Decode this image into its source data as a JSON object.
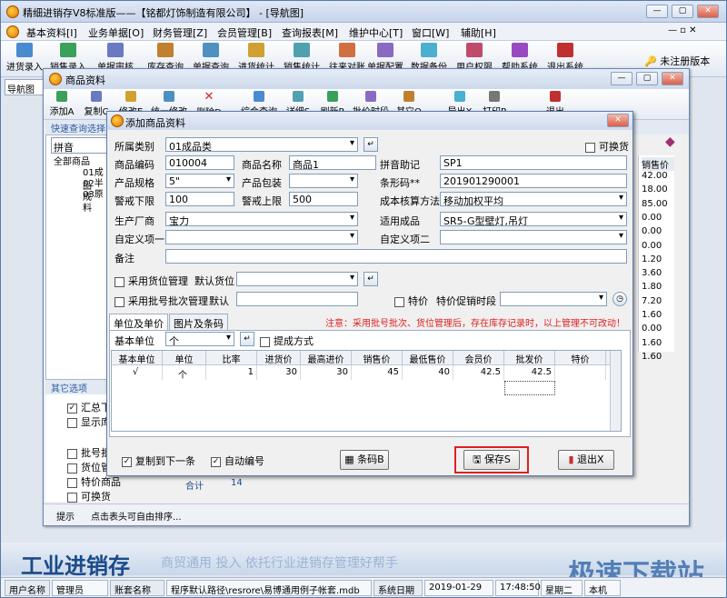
{
  "app": {
    "title": "精细进销存V8标准版——【铭都灯饰制造有限公司】 - [导航图]"
  },
  "menu": [
    "基本资料[I]",
    "业务单据[O]",
    "财务管理[Z]",
    "会员管理[B]",
    "查询报表[M]",
    "维护中心[T]",
    "窗口[W]",
    "辅助[H]"
  ],
  "toolbar": [
    "进货录入",
    "销售录入",
    "单据审核",
    "库存查询",
    "单据查询",
    "进货统计",
    "销售统计",
    "往来对账",
    "单据配置",
    "数据备份",
    "用户权限",
    "帮助系统",
    "退出系统"
  ],
  "unregistered": "未注册版本",
  "nav_tab": "导航图",
  "product_window": {
    "title": "商品资料",
    "toolbar": [
      "添加A",
      "复制C",
      "修改E",
      "统一修改",
      "删除D",
      "综合查询",
      "详细S",
      "刷新R",
      "批价时段",
      "其它O",
      "导出X",
      "打印P",
      "退出"
    ],
    "quick_query": "快速查询选择",
    "pinyin": "拼音",
    "tree": [
      "全部商品",
      "01成品",
      "02半成",
      "03原料"
    ],
    "other_options": "其它选项",
    "checks": [
      {
        "label": "汇总下",
        "checked": true
      },
      {
        "label": "显示库",
        "checked": false
      },
      {
        "label": "批号批",
        "checked": false
      },
      {
        "label": "货位管",
        "checked": false
      },
      {
        "label": "特价商品",
        "checked": false
      },
      {
        "label": "可换货",
        "checked": false
      }
    ],
    "right_header": "销售价",
    "right_values": [
      "42.00",
      "18.00",
      "85.00",
      "0.00",
      "0.00",
      "0.00",
      "1.20",
      "3.60",
      "1.80",
      "7.20",
      "1.60",
      "0.00",
      "1.60",
      "1.60"
    ],
    "total_label": "合计",
    "total_value": "14",
    "hint_label": "提示",
    "hint_text": "点击表头可自由排序..."
  },
  "dialog": {
    "title": "添加商品资料",
    "labels": {
      "category": "所属类别",
      "code": "商品编码",
      "name": "商品名称",
      "spec": "产品规格",
      "pack": "产品包装",
      "low": "警戒下限",
      "high": "警戒上限",
      "maker": "生产厂商",
      "custom1": "自定义项一",
      "remark": "备注",
      "mnemonic": "拼音助记",
      "barcode": "条形码**",
      "cost_method": "成本核算方法",
      "applicable": "适用成品",
      "custom2": "自定义项二",
      "exchangeable": "可换货",
      "location_mgmt": "采用货位管理",
      "default_location": "默认货位",
      "batch_mgmt": "采用批号批次管理",
      "default": "默认",
      "special": "特价",
      "special_period": "特价促销时段",
      "note": "注意：采用批号批次、货位管理后，存在库存记录时，以上管理不可改动！",
      "tab_units": "单位及单价",
      "tab_images": "图片及条码",
      "base_unit": "基本单位",
      "promote": "提成方式",
      "copy_next": "复制到下一条",
      "auto_number": "自动编号"
    },
    "values": {
      "category": "01成品类",
      "code": "010004",
      "name": "商品1",
      "spec": "5\"",
      "pack": "",
      "low": "100",
      "high": "500",
      "maker": "宝力",
      "custom1": "",
      "remark": "",
      "mnemonic": "SP1",
      "barcode": "201901290001",
      "cost_method": "移动加权平均",
      "applicable": "SR5-G型壁灯,吊灯",
      "custom2": "",
      "base_unit": "个"
    },
    "grid": {
      "headers": [
        "基本单位",
        "单位",
        "比率",
        "进货价",
        "最高进价",
        "销售价",
        "最低售价",
        "会员价",
        "批发价",
        "特价"
      ],
      "row": [
        "√",
        "个",
        "1",
        "30",
        "30",
        "45",
        "40",
        "42.5",
        "42.5",
        ""
      ]
    },
    "buttons": {
      "barcode": "条码B",
      "save": "保存S",
      "exit": "退出X"
    }
  },
  "status": {
    "user_label": "用户名称",
    "user": "管理员",
    "acct_label": "账套名称",
    "acct": "程序默认路径\\resrore\\易博通用例子帐套.mdb",
    "date_label": "系统日期",
    "date": "2019-01-29",
    "time": "17:48:50",
    "weekday": "星期二",
    "extra": "本机"
  },
  "footer": {
    "brand": "工业进销存",
    "slogan": "商贸通用  投入  依托行业进销存管理好帮手",
    "watermark": "极速下载站"
  },
  "colors": {
    "highlight": "#e02020",
    "accent": "#1a4a8a"
  }
}
